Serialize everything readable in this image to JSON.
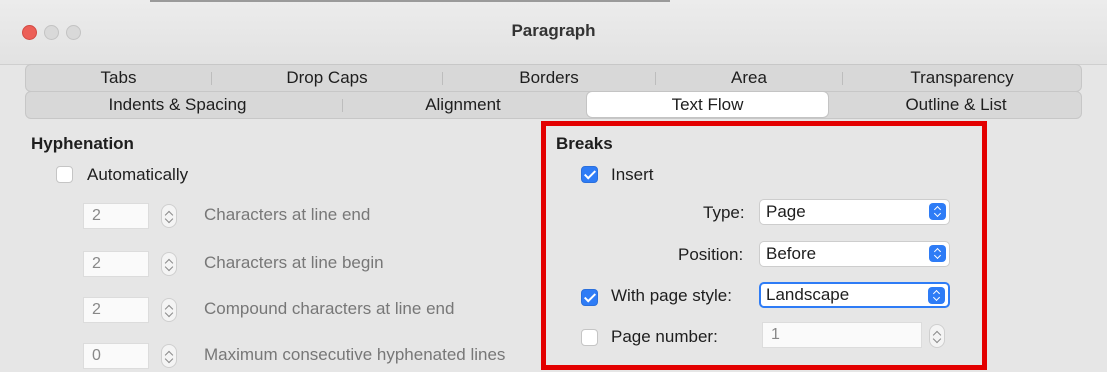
{
  "window": {
    "title": "Paragraph"
  },
  "tabs_row1": [
    {
      "label": "Tabs"
    },
    {
      "label": "Drop Caps"
    },
    {
      "label": "Borders"
    },
    {
      "label": "Area"
    },
    {
      "label": "Transparency"
    }
  ],
  "tabs_row2": [
    {
      "label": "Indents & Spacing"
    },
    {
      "label": "Alignment"
    },
    {
      "label": "Text Flow",
      "active": true
    },
    {
      "label": "Outline & List"
    }
  ],
  "hyphenation": {
    "heading": "Hyphenation",
    "automatically": {
      "label": "Automatically",
      "checked": false
    },
    "rows": [
      {
        "value": "2",
        "label": "Characters at line end"
      },
      {
        "value": "2",
        "label": "Characters at line begin"
      },
      {
        "value": "2",
        "label": "Compound characters at line end"
      },
      {
        "value": "0",
        "label": "Maximum consecutive hyphenated lines"
      }
    ]
  },
  "breaks": {
    "heading": "Breaks",
    "insert": {
      "label": "Insert",
      "checked": true
    },
    "type": {
      "label": "Type:",
      "value": "Page"
    },
    "position": {
      "label": "Position:",
      "value": "Before"
    },
    "with_page_style": {
      "label": "With page style:",
      "checked": true,
      "value": "Landscape"
    },
    "page_number": {
      "label": "Page number:",
      "checked": false,
      "value": "1"
    }
  },
  "colors": {
    "accent": "#2e7cf6",
    "highlight": "#e30000"
  }
}
